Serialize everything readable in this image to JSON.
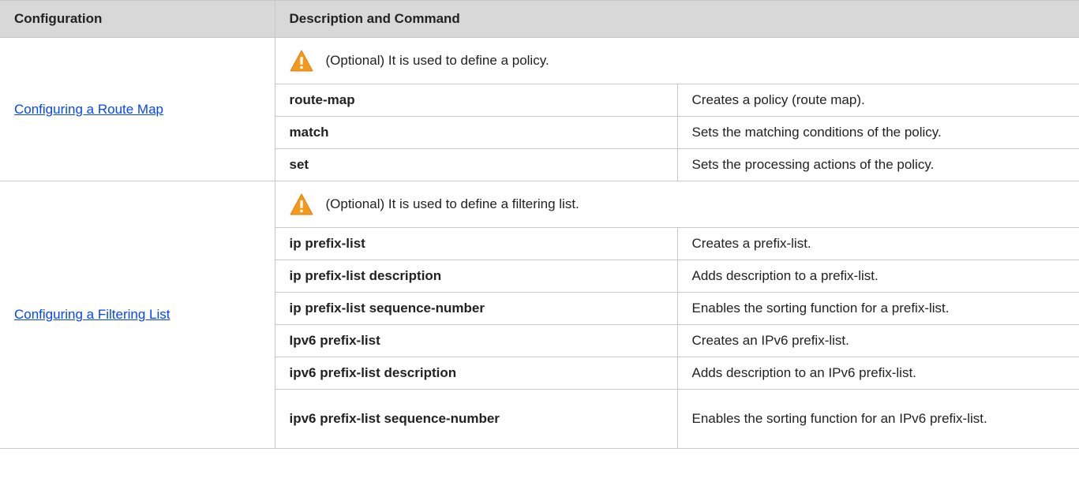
{
  "header": {
    "col_configuration": "Configuration",
    "col_description": "Description and Command"
  },
  "sections": [
    {
      "name": "Configuring a Route Map",
      "note": "(Optional) It is used to define a policy.",
      "commands": [
        {
          "command": "route-map",
          "description": "Creates a policy (route map)."
        },
        {
          "command": "match",
          "description": "Sets the matching conditions of the policy."
        },
        {
          "command": "set",
          "description": "Sets the processing actions of the policy."
        }
      ]
    },
    {
      "name": "Configuring a Filtering List",
      "note": "(Optional) It is used to define a filtering list.",
      "commands": [
        {
          "command": "ip prefix-list",
          "description": "Creates a prefix-list."
        },
        {
          "command": "ip prefix-list description",
          "description": "Adds description to a prefix-list."
        },
        {
          "command": "ip prefix-list sequence-number",
          "description": "Enables the sorting function for a prefix-list."
        },
        {
          "command": "Ipv6 prefix-list",
          "description": "Creates an IPv6 prefix-list."
        },
        {
          "command": "ipv6 prefix-list description",
          "description": "Adds description to an IPv6 prefix-list."
        },
        {
          "command": "ipv6 prefix-list sequence-number",
          "description": "Enables the sorting function for an IPv6 prefix-list."
        }
      ]
    }
  ],
  "icons": {
    "note_icon": "warning-triangle-icon"
  },
  "colors": {
    "link": "#0645ff",
    "header_bg": "#d8d8d8",
    "warning": "#f39a1e"
  }
}
